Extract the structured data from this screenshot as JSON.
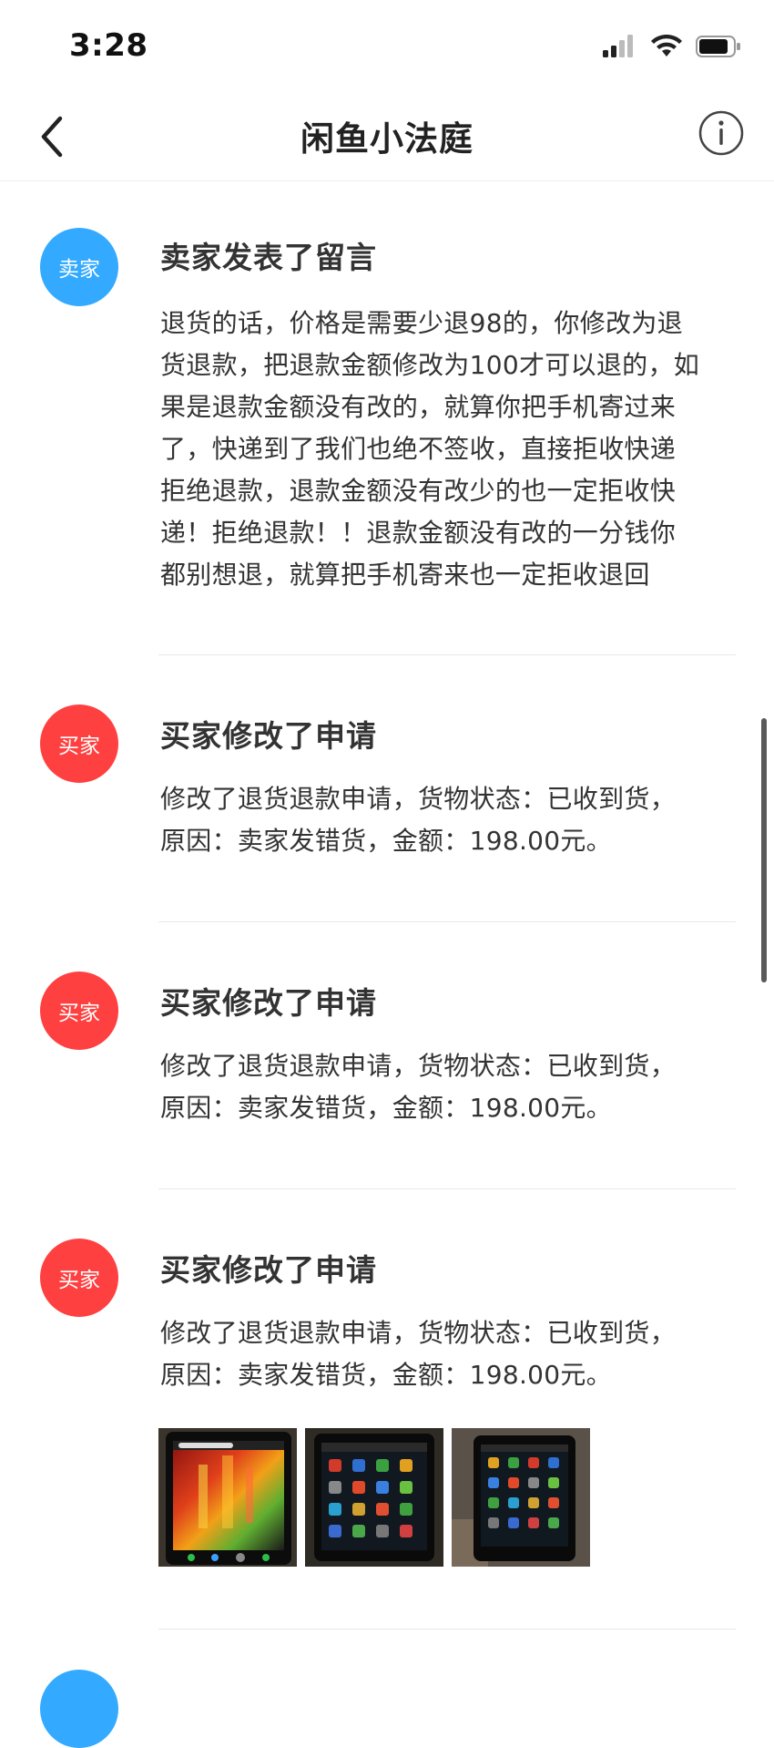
{
  "status_bar": {
    "time": "3:28"
  },
  "nav": {
    "title": "闲鱼小法庭"
  },
  "entries": [
    {
      "role": "卖家",
      "title": "卖家发表了留言",
      "lines": [
        "退货的话，价格是需要少退98的，你修改为退",
        "货退款，把退款金额修改为100才可以退的，如",
        "果是退款金额没有改的，就算你把手机寄过来",
        "了，快递到了我们也绝不签收，直接拒收快递",
        "拒绝退款，退款金额没有改少的也一定拒收快",
        "递！拒绝退款！！退款金额没有改的一分钱你",
        "都别想退，就算把手机寄来也一定拒收退回"
      ]
    },
    {
      "role": "买家",
      "title": "买家修改了申请",
      "lines": [
        "修改了退货退款申请，货物状态：已收到货，",
        "原因：卖家发错货，金额：198.00元。"
      ]
    },
    {
      "role": "买家",
      "title": "买家修改了申请",
      "lines": [
        "修改了退货退款申请，货物状态：已收到货，",
        "原因：卖家发错货，金额：198.00元。"
      ]
    },
    {
      "role": "买家",
      "title": "买家修改了申请",
      "lines": [
        "修改了退货退款申请，货物状态：已收到货，",
        "原因：卖家发错货，金额：198.00元。"
      ],
      "photos": [
        "phone-wallpaper-photo",
        "phone-app-grid-photo",
        "phone-app-grid-photo"
      ]
    }
  ],
  "colors": {
    "seller": "#33aaff",
    "buyer": "#ff4040",
    "divider": "#e8e8e8"
  }
}
